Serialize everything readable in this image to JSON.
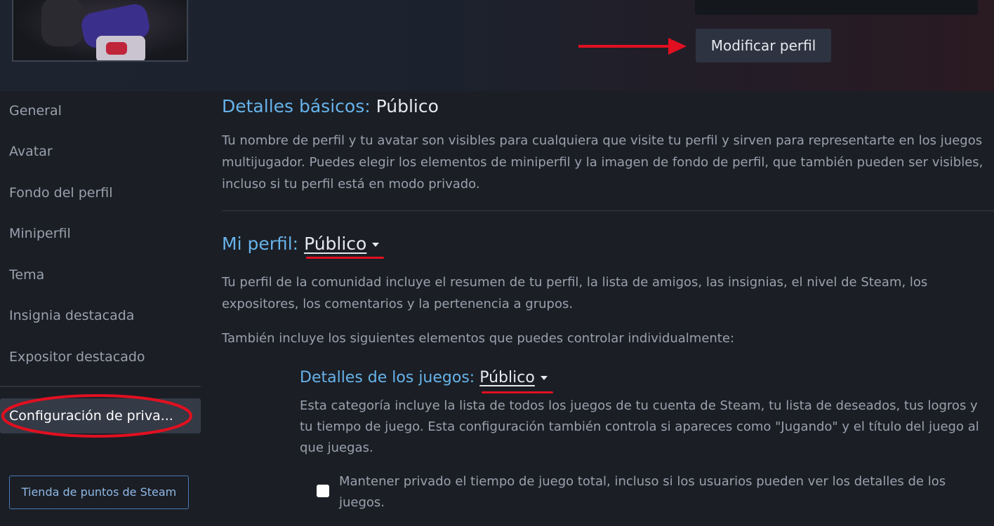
{
  "header": {
    "edit_profile_label": "Modificar perfil"
  },
  "sidebar": {
    "items": [
      {
        "label": "General"
      },
      {
        "label": "Avatar"
      },
      {
        "label": "Fondo del perfil"
      },
      {
        "label": "Miniperfil"
      },
      {
        "label": "Tema"
      },
      {
        "label": "Insignia destacada"
      },
      {
        "label": "Expositor destacado"
      }
    ],
    "active_label": "Configuración de priva...",
    "points_shop_label": "Tienda de puntos de Steam"
  },
  "main": {
    "basic": {
      "label": "Detalles básicos:",
      "value": "Público",
      "description": "Tu nombre de perfil y tu avatar son visibles para cualquiera que visite tu perfil y sirven para representarte en los juegos multijugador. Puedes elegir los elementos de miniperfil y la imagen de fondo de perfil, que también pueden ser visibles, incluso si tu perfil está en modo privado."
    },
    "my_profile": {
      "label": "Mi perfil:",
      "value": "Público",
      "description": "Tu perfil de la comunidad incluye el resumen de tu perfil, la lista de amigos, las insignias, el nivel de Steam, los expositores, los comentarios y la pertenencia a grupos.",
      "also_includes": "También incluye los siguientes elementos que puedes controlar individualmente:"
    },
    "game_details": {
      "label": "Detalles de los juegos:",
      "value": "Público",
      "description": "Esta categoría incluye la lista de todos los juegos de tu cuenta de Steam, tu lista de deseados, tus logros y tu tiempo de juego. Esta configuración también controla si apareces como \"Jugando\" y el título del juego al que juegas.",
      "checkbox_label": "Mantener privado el tiempo de juego total, incluso si los usuarios pueden ver los detalles de los juegos.",
      "checkbox_checked": false
    }
  },
  "colors": {
    "accent_blue": "#66b3ea",
    "annotation_red": "#e01020",
    "background": "#1b1e25"
  }
}
